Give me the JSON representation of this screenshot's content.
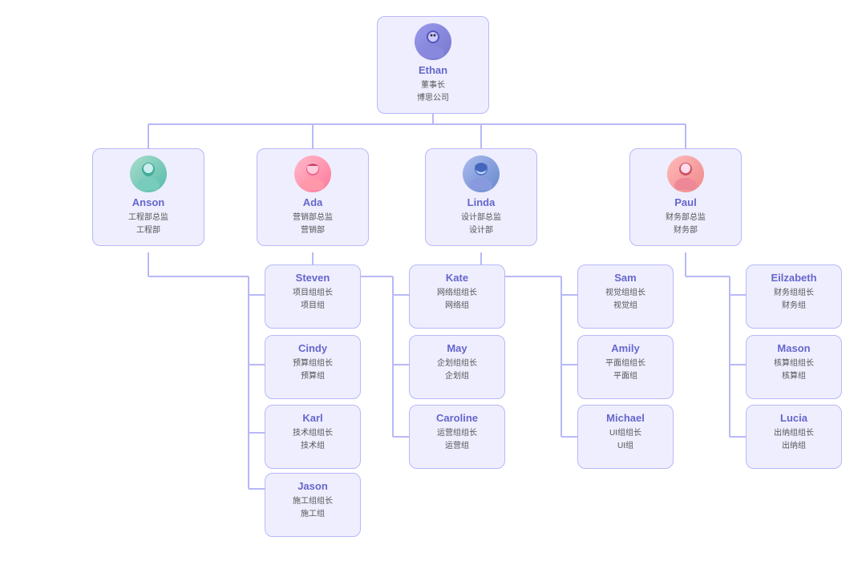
{
  "chart": {
    "background": "#ffffff",
    "root": {
      "name": "Ethan",
      "role1": "董事长",
      "role2": "博思公司",
      "avatar_color": "#7777dd",
      "avatar_type": "male_blue"
    },
    "level1": [
      {
        "name": "Anson",
        "role1": "工程部总监",
        "role2": "工程部",
        "avatar_type": "male_teal",
        "children": [
          {
            "name": "Steven",
            "role1": "项目组组长",
            "role2": "项目组"
          },
          {
            "name": "Cindy",
            "role1": "预算组组长",
            "role2": "预算组"
          },
          {
            "name": "Karl",
            "role1": "技术组组长",
            "role2": "技术组"
          },
          {
            "name": "Jason",
            "role1": "施工组组长",
            "role2": "施工组"
          }
        ]
      },
      {
        "name": "Ada",
        "role1": "营销部总监",
        "role2": "营销部",
        "avatar_type": "female_pink",
        "children": [
          {
            "name": "Kate",
            "role1": "网络组组长",
            "role2": "网络组"
          },
          {
            "name": "May",
            "role1": "企划组组长",
            "role2": "企划组"
          },
          {
            "name": "Caroline",
            "role1": "运营组组长",
            "role2": "运营组"
          }
        ]
      },
      {
        "name": "Linda",
        "role1": "设计部总监",
        "role2": "设计部",
        "avatar_type": "female_blue",
        "children": [
          {
            "name": "Sam",
            "role1": "视觉组组长",
            "role2": "视觉组"
          },
          {
            "name": "Amily",
            "role1": "平面组组长",
            "role2": "平面组"
          },
          {
            "name": "Michael",
            "role1": "UI组组长",
            "role2": "UI组"
          }
        ]
      },
      {
        "name": "Paul",
        "role1": "财务部总监",
        "role2": "财务部",
        "avatar_type": "male_pink",
        "children": [
          {
            "name": "Eilzabeth",
            "role1": "财务组组长",
            "role2": "财务组"
          },
          {
            "name": "Mason",
            "role1": "核算组组长",
            "role2": "核算组"
          },
          {
            "name": "Lucia",
            "role1": "出纳组组长",
            "role2": "出纳组"
          }
        ]
      }
    ]
  }
}
